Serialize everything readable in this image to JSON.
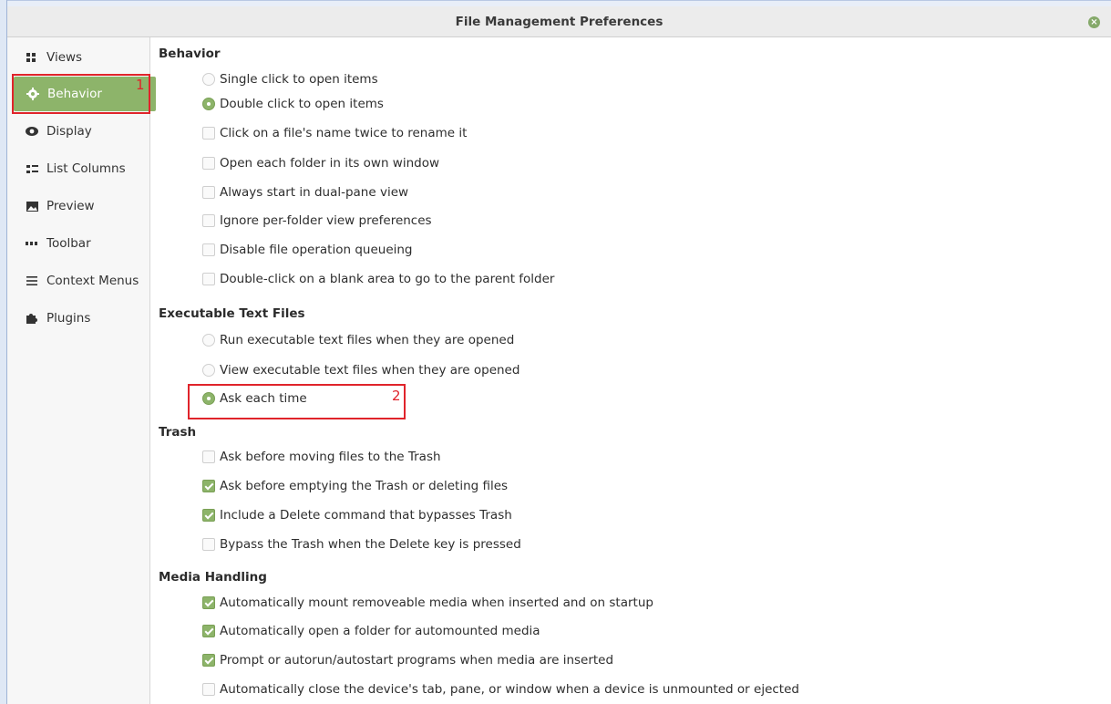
{
  "window": {
    "title": "File Management Preferences"
  },
  "sidebar": {
    "items": [
      {
        "label": "Views"
      },
      {
        "label": "Behavior"
      },
      {
        "label": "Display"
      },
      {
        "label": "List Columns"
      },
      {
        "label": "Preview"
      },
      {
        "label": "Toolbar"
      },
      {
        "label": "Context Menus"
      },
      {
        "label": "Plugins"
      }
    ]
  },
  "annotations": {
    "one": "1",
    "two": "2"
  },
  "behavior": {
    "heading": "Behavior",
    "single_click": "Single click to open items",
    "double_click": "Double click to open items",
    "rename_twice": "Click on a file's name twice to rename it",
    "own_window": "Open each folder in its own window",
    "dual_pane": "Always start in dual-pane view",
    "ignore_prefs": "Ignore per-folder view preferences",
    "disable_queue": "Disable file operation queueing",
    "blank_parent": "Double-click on a blank area to go to the parent folder"
  },
  "executable": {
    "heading": "Executable Text Files",
    "run": "Run executable text files when they are opened",
    "view": "View executable text files when they are opened",
    "ask": "Ask each time"
  },
  "trash": {
    "heading": "Trash",
    "ask_move": "Ask before moving files to the Trash",
    "ask_empty": "Ask before emptying the Trash or deleting files",
    "delete_cmd": "Include a Delete command that bypasses Trash",
    "bypass_key": "Bypass the Trash when the Delete key is pressed"
  },
  "media": {
    "heading": "Media Handling",
    "auto_mount": "Automatically mount removeable media when inserted and on startup",
    "auto_open": "Automatically open a folder for automounted media",
    "prompt_autorun": "Prompt or autorun/autostart programs when media are inserted",
    "auto_close": "Automatically close the device's tab, pane, or window when a device is unmounted or ejected"
  },
  "colors": {
    "accent": "#8db46a",
    "highlight": "#e0242b"
  }
}
